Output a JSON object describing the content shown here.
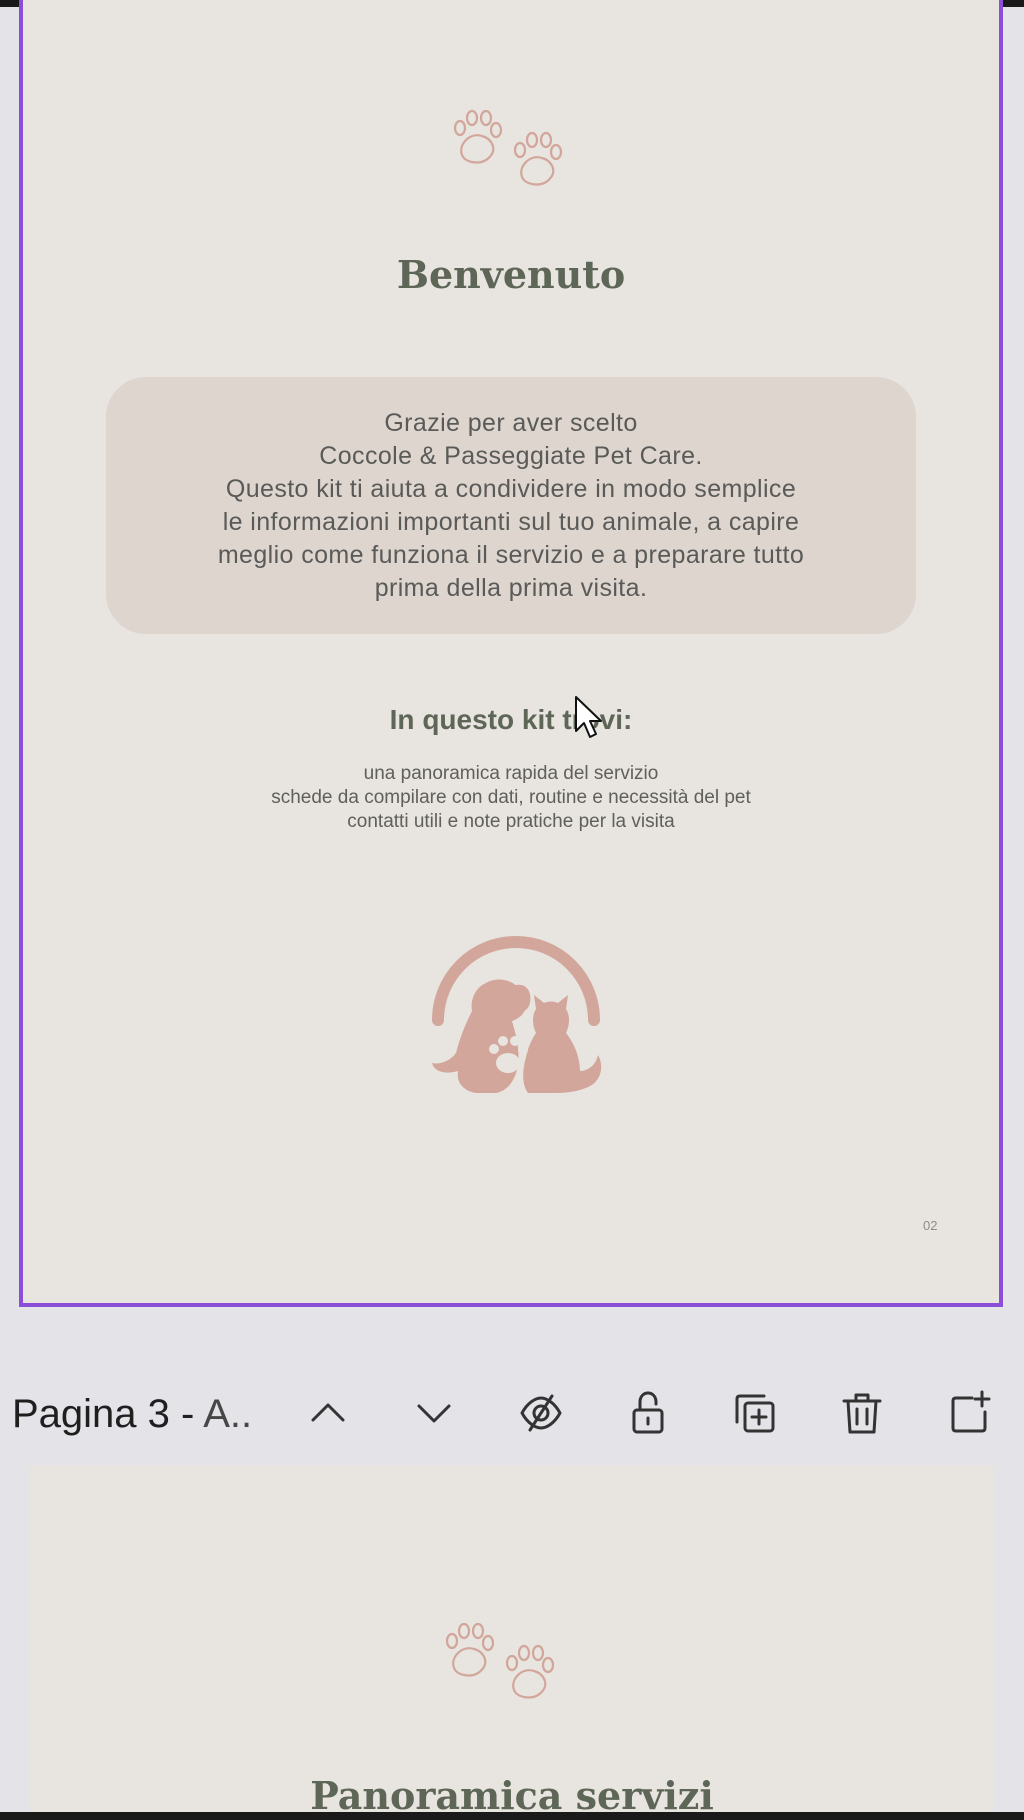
{
  "page2": {
    "title": "Benvenuto",
    "intro_lines": [
      "Grazie per aver scelto",
      "Coccole & Passeggiate Pet Care.",
      "Questo kit ti aiuta a condividere in modo semplice",
      "le informazioni importanti sul tuo animale, a capire",
      "meglio come funziona il servizio e a preparare tutto",
      "prima della prima visita."
    ],
    "kit_heading": "In questo kit trovi:",
    "kit_items": [
      "una panoramica rapida del servizio",
      "schede da compilare con dati, routine e necessità del pet",
      "contatti utili e note pratiche per la visita"
    ],
    "page_number": "02",
    "icons": {
      "paws": "paw-prints-icon",
      "logo": "dog-cat-logo"
    },
    "colors": {
      "background": "#e8e4df",
      "accent": "#d2a69a",
      "title": "#5d6657",
      "box": "#ddd5ce",
      "selection": "#8b4ed6"
    }
  },
  "toolbar": {
    "page_label": "Pagina 3 - ",
    "page_label_sub": "A..",
    "icons": [
      "chevron-up-icon",
      "chevron-down-icon",
      "eye-off-icon",
      "lock-open-icon",
      "duplicate-icon",
      "trash-icon",
      "add-page-icon"
    ]
  },
  "page3": {
    "title": "Panoramica servizi"
  }
}
